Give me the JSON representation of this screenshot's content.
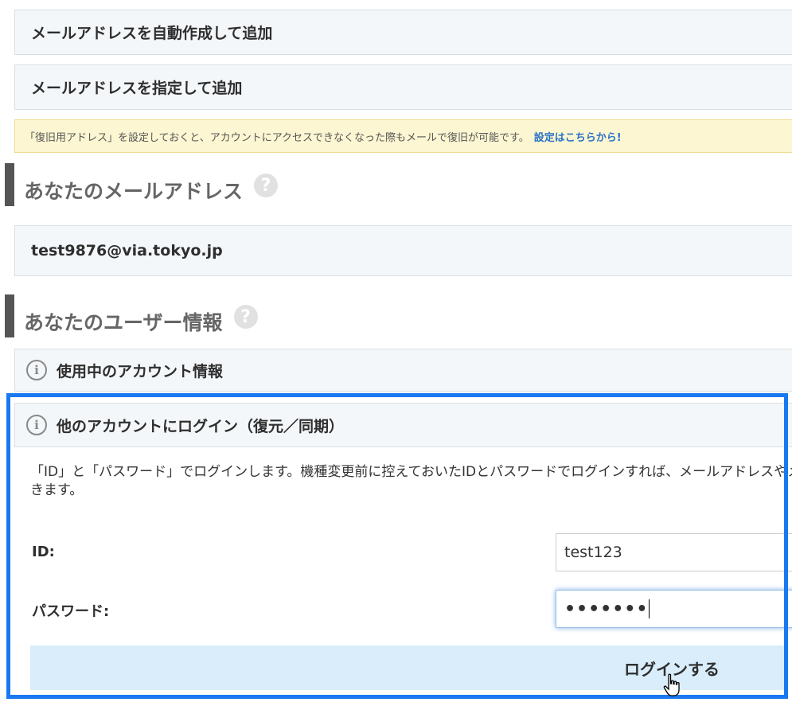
{
  "actions": {
    "auto_create_label": "メールアドレスを自動作成して追加",
    "specify_label": "メールアドレスを指定して追加"
  },
  "notice": {
    "text": "「復旧用アドレス」を設定しておくと、アカウントにアクセスできなくなった際もメールで復旧が可能です。",
    "link_label": "設定はこちらから!"
  },
  "email_section": {
    "title": "あなたのメールアドレス",
    "help_icon": "question-circle-icon",
    "email": "test9876@via.tokyo.jp"
  },
  "user_section": {
    "title": "あなたのユーザー情報",
    "help_icon": "question-circle-icon",
    "current_account_label": "使用中のアカウント情報",
    "other_account_label": "他のアカウントにログイン（復元／同期）",
    "info_icon": "info-circle-icon"
  },
  "login_form": {
    "description": "「ID」と「パスワード」でログインします。機種変更前に控えておいたIDとパスワードでログインすれば、メールアドレスやメールを再",
    "description_cont": "きます。",
    "id_label": "ID:",
    "id_value": "test123",
    "password_label": "パスワード:",
    "password_value": "•••••••",
    "login_button": "ログインする"
  },
  "colors": {
    "highlight": "#1a78f0",
    "link": "#2b73c8",
    "notice_bg": "#fdf6d2",
    "button_bg": "#d9edfb"
  }
}
